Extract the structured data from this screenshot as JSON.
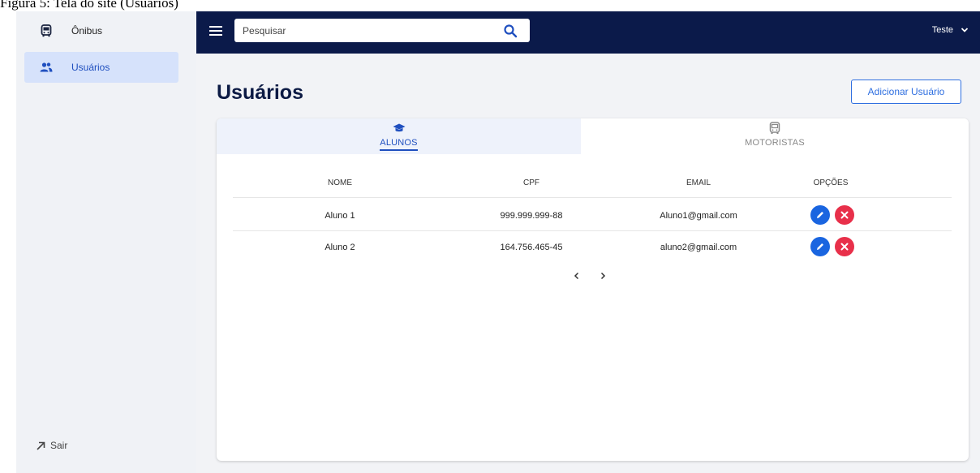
{
  "caption": "Figura 5: Tela do site (Usuários)",
  "sidebar": {
    "items": [
      {
        "label": "Ônibus",
        "icon": "bus-icon",
        "active": false
      },
      {
        "label": "Usuários",
        "icon": "users-icon",
        "active": true
      }
    ],
    "logout_label": "Sair"
  },
  "topbar": {
    "search_placeholder": "Pesquisar",
    "user_name": "Teste"
  },
  "main": {
    "title": "Usuários",
    "add_button_label": "Adicionar Usuário",
    "tabs": [
      {
        "label": "ALUNOS",
        "icon": "graduation-cap-icon",
        "active": true
      },
      {
        "label": "MOTORISTAS",
        "icon": "bus-icon",
        "active": false
      }
    ],
    "table": {
      "columns": [
        "NOME",
        "CPF",
        "EMAIL",
        "OPÇÕES"
      ],
      "rows": [
        {
          "nome": "Aluno 1",
          "cpf": "999.999.999-88",
          "email": "Aluno1@gmail.com"
        },
        {
          "nome": "Aluno 2",
          "cpf": "164.756.465-45",
          "email": "aluno2@gmail.com"
        }
      ]
    }
  },
  "colors": {
    "topbar": "#0b1a4a",
    "accent": "#1f4fbf",
    "edit": "#1a65e0",
    "delete": "#e8304a"
  }
}
